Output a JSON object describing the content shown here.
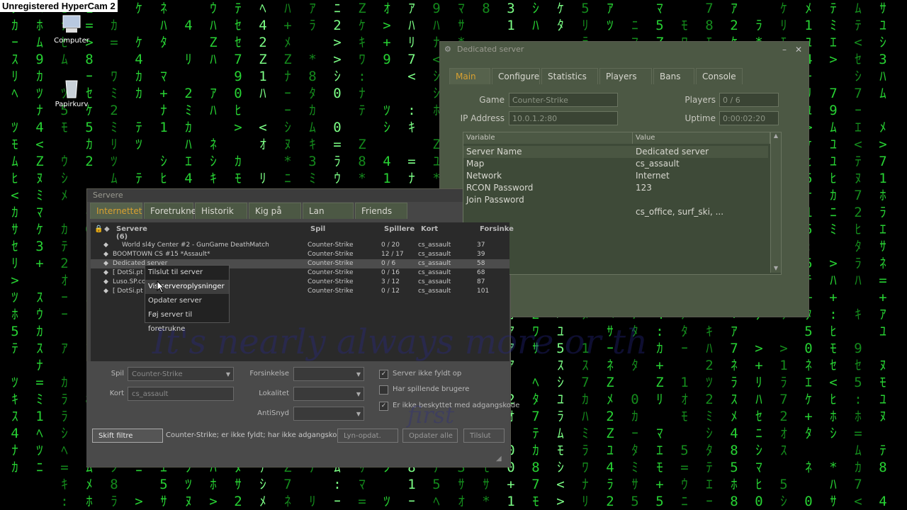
{
  "recorder": {
    "watermark": "Unregistered HyperCam 2"
  },
  "desktop": {
    "icons": [
      {
        "label": "Computer"
      },
      {
        "label": "Papirkurv"
      }
    ],
    "overlay_text": "It's nearly always more or th",
    "overlay_text2": "first"
  },
  "dedicated": {
    "title": "Dedicated server",
    "tabs": [
      "Main",
      "Configure",
      "Statistics",
      "Players",
      "Bans",
      "Console"
    ],
    "game_label": "Game",
    "game_value": "Counter-Strike",
    "ip_label": "IP Address",
    "ip_value": "10.0.1.2:80",
    "players_label": "Players",
    "players_value": "0 / 6",
    "uptime_label": "Uptime",
    "uptime_value": "0:00:02:20",
    "columns": [
      "Variable",
      "Value"
    ],
    "rows": [
      {
        "var": "Server Name",
        "val": "Dedicated server"
      },
      {
        "var": "Map",
        "val": "cs_assault"
      },
      {
        "var": "Network",
        "val": "Internet"
      },
      {
        "var": "RCON Password",
        "val": "123"
      },
      {
        "var": "Join Password",
        "val": ""
      },
      {
        "var": "",
        "val": "cs_office, surf_ski, ..."
      }
    ]
  },
  "servers": {
    "title": "Servere",
    "tabs": [
      "Internettet",
      "Foretrukne",
      "Historik",
      "Kig på",
      "Lan",
      "Friends"
    ],
    "headers": {
      "name": "Servere (6)",
      "game": "Spil",
      "players": "Spillere",
      "map": "Kort",
      "latency": "Forsinke"
    },
    "rows": [
      {
        "name": "World sl4y Center #2 - GunGame DeathMatch",
        "game": "Counter-Strike",
        "players": "0 / 20",
        "map": "cs_assault",
        "latency": "37"
      },
      {
        "name": "BOOMTOWN CS #15 *Assault*",
        "game": "Counter-Strike",
        "players": "12 / 17",
        "map": "cs_assault",
        "latency": "39"
      },
      {
        "name": "Dedicated server",
        "game": "Counter-Strike",
        "players": "0 / 6",
        "map": "cs_assault",
        "latency": "58"
      },
      {
        "name": "[ DotSi.pt",
        "game": "Counter-Strike",
        "players": "0 / 16",
        "map": "cs_assault",
        "latency": "68"
      },
      {
        "name": "Luso.SP.co",
        "game": "Counter-Strike",
        "players": "3 / 12",
        "map": "cs_assault",
        "latency": "87"
      },
      {
        "name": "[ DotSi.pt",
        "game": "Counter-Strike",
        "players": "0 / 12",
        "map": "cs_assault",
        "latency": "101"
      }
    ],
    "context_menu": [
      "Tilslut til server",
      "Vis serveroplysninger",
      "Opdater server",
      "Føj server til foretrukne"
    ],
    "filters": {
      "spil_label": "Spil",
      "spil_value": "Counter-Strike",
      "kort_label": "Kort",
      "kort_value": "cs_assault",
      "forsinkelse_label": "Forsinkelse",
      "lokalitet_label": "Lokalitet",
      "antisnyd_label": "AntiSnyd",
      "check1": "Server ikke fyldt op",
      "check2": "Har spillende brugere",
      "check3": "Er ikke beskyttet med adgangskode"
    },
    "bottom": {
      "toggle_filters": "Skift filtre",
      "status": "Counter-Strike; er ikke fyldt; har ikke adgangskode;..",
      "quick_refresh": "Lyn-opdat.",
      "refresh_all": "Opdater alle",
      "connect": "Tilslut"
    }
  }
}
